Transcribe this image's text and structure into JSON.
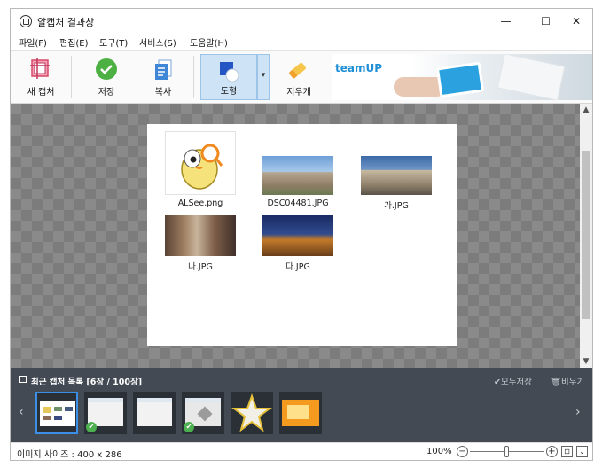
{
  "window": {
    "title": "알캡처 결과창",
    "minimize": "—",
    "maximize": "☐",
    "close": "✕"
  },
  "menu": [
    "파일(F)",
    "편집(E)",
    "도구(T)",
    "서비스(S)",
    "도움말(H)"
  ],
  "toolbar": {
    "new_capture": "새 캡처",
    "save": "저장",
    "copy": "복사",
    "shape": "도형",
    "shape_arrow": "▾",
    "eraser": "지우개"
  },
  "banner": {
    "logo": "teamUP"
  },
  "captured_image": {
    "files": [
      {
        "name": "ALSee.png",
        "kind": "alsee-mascot"
      },
      {
        "name": "DSC04481.JPG",
        "kind": "photo-building"
      },
      {
        "name": "가.JPG",
        "kind": "photo-palace"
      },
      {
        "name": "나.JPG",
        "kind": "photo-shop"
      },
      {
        "name": "다.JPG",
        "kind": "photo-night"
      }
    ]
  },
  "recent": {
    "title": "최근 캡처 목록 [6장 / 100장]",
    "save_all": "✔모두저장",
    "clear_all": "🗑비우기",
    "prev": "‹",
    "next": "›",
    "check": "✔",
    "thumbnails": [
      {
        "kind": "explorer",
        "selected": true,
        "saved": false
      },
      {
        "kind": "explorer",
        "selected": false,
        "saved": true
      },
      {
        "kind": "explorer",
        "selected": false,
        "saved": false
      },
      {
        "kind": "explorer",
        "selected": false,
        "saved": true
      },
      {
        "kind": "star",
        "selected": false,
        "saved": false
      },
      {
        "kind": "orange",
        "selected": false,
        "saved": false
      }
    ]
  },
  "status": {
    "image_size": "이미지 사이즈 : 400 x 286",
    "zoom": "100%",
    "zoom_level": 0.5,
    "zoom_minus": "−",
    "zoom_plus": "+",
    "fit": "⊡",
    "dropdown": "⌄"
  },
  "scroll": {
    "up": "▲",
    "down": "▼"
  },
  "colors": {
    "accent": "#3b8fe6",
    "panel": "#434a53",
    "save_green": "#4caf50",
    "shape_highlight": "#cfe3f6"
  }
}
